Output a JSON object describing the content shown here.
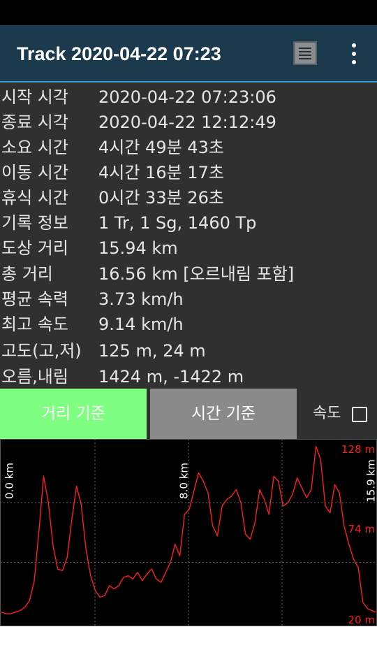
{
  "app_bar": {
    "title": "Track 2020-04-22 07:23",
    "icons": [
      "list-view-icon",
      "more-vert-icon"
    ]
  },
  "info_rows": [
    {
      "label": "시작 시각",
      "value": "2020-04-22 07:23:06"
    },
    {
      "label": "종료 시각",
      "value": "2020-04-22 12:12:49"
    },
    {
      "label": "소요 시간",
      "value": "4시간 49분 43초"
    },
    {
      "label": "이동 시간",
      "value": "4시간 16분 17초"
    },
    {
      "label": "휴식 시간",
      "value": "0시간 33분 26초"
    },
    {
      "label": "기록 정보",
      "value": "1 Tr, 1 Sg, 1460 Tp"
    },
    {
      "label": "도상 거리",
      "value": "15.94 km"
    },
    {
      "label": "총 거리",
      "value": "16.56 km [오르내림 포함]"
    },
    {
      "label": "평균 속력",
      "value": "3.73 km/h"
    },
    {
      "label": "최고 속도",
      "value": "9.14 km/h"
    },
    {
      "label": "고도(고,저)",
      "value": "125 m, 24 m"
    },
    {
      "label": "오름,내림",
      "value": "1424 m, -1422 m"
    }
  ],
  "controls": {
    "distance_basis": "거리 기준",
    "time_basis": "시간 기준",
    "speed_label": "속도",
    "speed_checked": false
  },
  "colors": {
    "app_bar": "#1c3a4e",
    "panel": "#303030",
    "active_button": "#7fff82",
    "inactive_button": "#8a8a8a",
    "chart_line": "#ff1e1e"
  },
  "chart_data": {
    "type": "line",
    "title": "",
    "x_axis": {
      "unit": "km",
      "range": [
        0,
        15.94
      ],
      "tick_labels": [
        "0.0 km",
        "8.0 km",
        "15.9 km"
      ]
    },
    "y_axis": {
      "unit": "m",
      "range": [
        20,
        128
      ],
      "tick_labels": [
        "128 m",
        "74 m",
        "20 m"
      ]
    },
    "grid": true,
    "series": [
      {
        "x": [
          0,
          0.2,
          0.4,
          0.6,
          0.8,
          1.0,
          1.2,
          1.4,
          1.6,
          1.8,
          2.0,
          2.2,
          2.4,
          2.6,
          2.8,
          3.0,
          3.2,
          3.4,
          3.6,
          3.8,
          4.0,
          4.2,
          4.4,
          4.6,
          4.8,
          5.0,
          5.2,
          5.4,
          5.6,
          5.8,
          6.0,
          6.2,
          6.4,
          6.6,
          6.8,
          7.0,
          7.2,
          7.4,
          7.6,
          7.8,
          8.0,
          8.2,
          8.4,
          8.6,
          8.8,
          9.0,
          9.2,
          9.4,
          9.6,
          9.8,
          10.0,
          10.2,
          10.4,
          10.6,
          10.8,
          11.0,
          11.2,
          11.4,
          11.6,
          11.8,
          12.0,
          12.2,
          12.4,
          12.6,
          12.8,
          13.0,
          13.2,
          13.4,
          13.6,
          13.8,
          14.0,
          14.2,
          14.4,
          14.6,
          14.8,
          15.0,
          15.2,
          15.4,
          15.6,
          15.94
        ],
        "y": [
          26,
          25,
          25,
          26,
          27,
          29,
          33,
          45,
          75,
          108,
          92,
          66,
          52,
          51,
          59,
          82,
          102,
          91,
          64,
          48,
          39,
          35,
          36,
          42,
          40,
          42,
          47,
          48,
          46,
          50,
          45,
          49,
          52,
          46,
          44,
          50,
          56,
          67,
          60,
          85,
          88,
          99,
          110,
          105,
          98,
          78,
          72,
          90,
          94,
          96,
          100,
          92,
          73,
          70,
          80,
          100,
          94,
          85,
          108,
          105,
          90,
          92,
          97,
          107,
          101,
          95,
          100,
          126,
          118,
          90,
          86,
          103,
          98,
          78,
          67,
          58,
          53,
          32,
          28,
          26
        ]
      }
    ]
  }
}
